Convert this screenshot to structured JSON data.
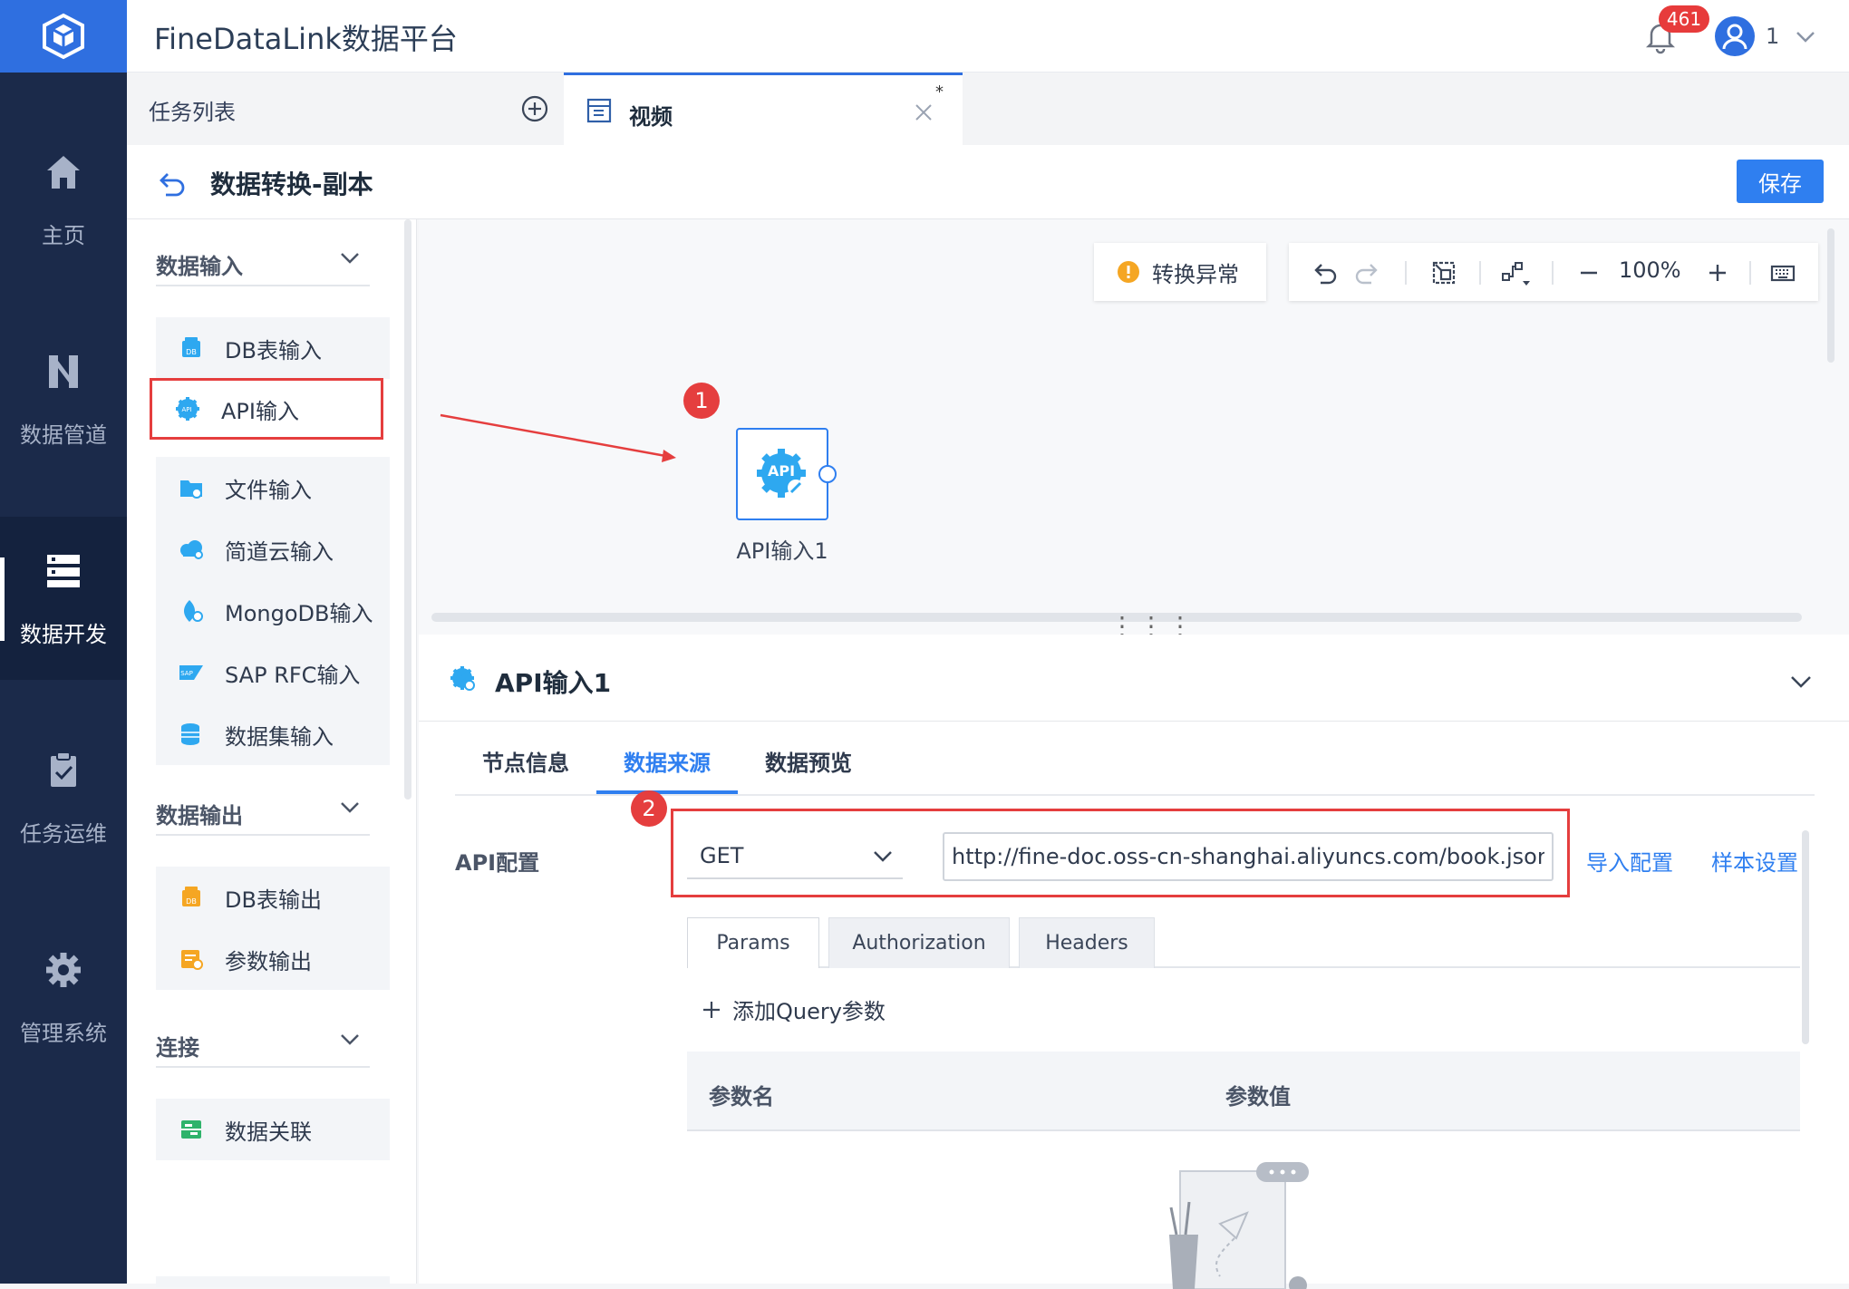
{
  "app": {
    "title": "FineDataLink数据平台",
    "notifications": "461",
    "user": "1"
  },
  "nav": [
    {
      "label": "主页",
      "icon": "home-icon"
    },
    {
      "label": "数据管道",
      "icon": "pipeline-icon"
    },
    {
      "label": "数据开发",
      "icon": "dev-icon",
      "active": true
    },
    {
      "label": "任务运维",
      "icon": "clipboard-icon"
    },
    {
      "label": "管理系统",
      "icon": "gear-icon"
    }
  ],
  "tabs": {
    "list_label": "任务列表",
    "active": {
      "label": "视频",
      "modified_mark": "*"
    }
  },
  "title_bar": {
    "title": "数据转换-副本",
    "save_label": "保存"
  },
  "panel": {
    "groups": [
      {
        "title": "数据输入",
        "items": [
          "DB表输入",
          "API输入",
          "文件输入",
          "简道云输入",
          "MongoDB输入",
          "SAP RFC输入",
          "数据集输入"
        ]
      },
      {
        "title": "数据输出",
        "items": [
          "DB表输出",
          "参数输出"
        ]
      },
      {
        "title": "连接",
        "items": [
          "数据关联"
        ]
      }
    ]
  },
  "canvas": {
    "exception_label": "转换异常",
    "zoom": "100%",
    "node": {
      "label": "API输入1",
      "icon_text": "API"
    },
    "markers": [
      "1",
      "2"
    ],
    "accent": "#2f7ff0",
    "highlight": "#e53e3e"
  },
  "props": {
    "title": "API输入1",
    "tabs": [
      "节点信息",
      "数据来源",
      "数据预览"
    ],
    "active_tab": "数据来源",
    "api_label": "API配置",
    "method": "GET",
    "url": "http://fine-doc.oss-cn-shanghai.aliyuncs.com/book.json",
    "import_config": "导入配置",
    "sample_settings": "样本设置",
    "subtabs": [
      "Params",
      "Authorization",
      "Headers"
    ],
    "add_query": "添加Query参数",
    "table_headers": [
      "参数名",
      "参数值"
    ]
  }
}
